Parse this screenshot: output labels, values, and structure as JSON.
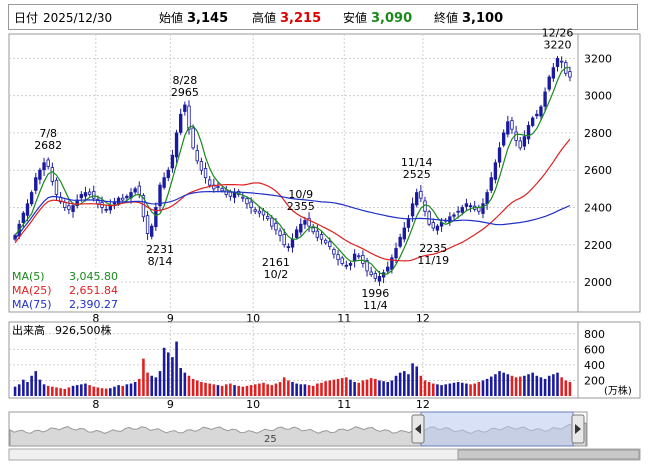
{
  "header": {
    "date_label": "日付",
    "date": "2025/12/30",
    "open_label": "始値",
    "open": "3,145",
    "high_label": "高値",
    "high": "3,215",
    "low_label": "安値",
    "low": "3,090",
    "close_label": "終値",
    "close": "3,100"
  },
  "colors": {
    "up": "#1a1aa0",
    "down": "#ffffff",
    "candle_border": "#1a1aa0",
    "ma5": "#1a8a1a",
    "ma25": "#e02020",
    "ma75": "#2030c8",
    "high_value": "#e00000",
    "low_value": "#1a8a1a",
    "volume_up": "#1a1aa0",
    "volume_down": "#e02020",
    "nav_fill": "#b8c8ee"
  },
  "legend": [
    {
      "label": "MA(5)",
      "value": "3,045.80",
      "color": "#1a8a1a"
    },
    {
      "label": "MA(25)",
      "value": "2,651.84",
      "color": "#e02020"
    },
    {
      "label": "MA(75)",
      "value": "2,390.27",
      "color": "#2030c8"
    }
  ],
  "volume_label": "出来高",
  "volume_value": "926,500株",
  "volume_unit": "(万株)",
  "navigator_label": "25",
  "chart_data": {
    "type": "candlestick",
    "price_ylim": [
      1850,
      3320
    ],
    "price_ticks": [
      2000,
      2200,
      2400,
      2600,
      2800,
      3000,
      3200
    ],
    "volume_ylim": [
      0,
      900
    ],
    "volume_ticks": [
      200,
      400,
      600,
      800
    ],
    "month_labels": [
      {
        "label": "8",
        "month": "2025-08"
      },
      {
        "label": "9",
        "month": "2025-09"
      },
      {
        "label": "10",
        "month": "2025-10"
      },
      {
        "label": "11",
        "month": "2025-11"
      },
      {
        "label": "12",
        "month": "2025-12"
      }
    ],
    "annotations": [
      {
        "date": "7/8",
        "value": "2682",
        "price": 2682,
        "where": "above"
      },
      {
        "date": "8/14",
        "value": "2231",
        "price": 2231,
        "where": "below"
      },
      {
        "date": "8/28",
        "value": "2965",
        "price": 2965,
        "where": "above"
      },
      {
        "date": "10/2",
        "value": "2161",
        "price": 2161,
        "where": "below"
      },
      {
        "date": "10/9",
        "value": "2355",
        "price": 2355,
        "where": "above"
      },
      {
        "date": "11/4",
        "value": "1996",
        "price": 1996,
        "where": "below"
      },
      {
        "date": "11/14",
        "value": "2525",
        "price": 2525,
        "where": "above"
      },
      {
        "date": "11/19",
        "value": "2235",
        "price": 2235,
        "where": "below"
      },
      {
        "date": "12/26",
        "value": "3220",
        "price": 3220,
        "where": "above"
      }
    ],
    "closes": [
      2250,
      2310,
      2370,
      2420,
      2480,
      2560,
      2600,
      2640,
      2620,
      2540,
      2470,
      2430,
      2400,
      2390,
      2410,
      2440,
      2470,
      2480,
      2470,
      2450,
      2420,
      2400,
      2390,
      2410,
      2430,
      2450,
      2440,
      2460,
      2480,
      2500,
      2470,
      2350,
      2260,
      2300,
      2400,
      2520,
      2560,
      2600,
      2680,
      2800,
      2900,
      2950,
      2820,
      2720,
      2650,
      2600,
      2560,
      2520,
      2500,
      2510,
      2490,
      2470,
      2460,
      2480,
      2470,
      2450,
      2420,
      2400,
      2380,
      2370,
      2360,
      2340,
      2300,
      2280,
      2250,
      2200,
      2190,
      2230,
      2280,
      2310,
      2330,
      2300,
      2270,
      2240,
      2230,
      2210,
      2190,
      2150,
      2120,
      2100,
      2090,
      2100,
      2150,
      2140,
      2100,
      2060,
      2040,
      2020,
      2030,
      2050,
      2080,
      2130,
      2180,
      2240,
      2290,
      2340,
      2420,
      2480,
      2450,
      2380,
      2310,
      2290,
      2300,
      2320,
      2330,
      2350,
      2360,
      2380,
      2400,
      2420,
      2410,
      2390,
      2380,
      2420,
      2480,
      2560,
      2640,
      2720,
      2800,
      2860,
      2820,
      2760,
      2720,
      2780,
      2840,
      2880,
      2900,
      2940,
      3020,
      3100,
      3150,
      3200,
      3180,
      3120,
      3100
    ],
    "volumes": [
      120,
      150,
      210,
      180,
      260,
      320,
      210,
      150,
      130,
      120,
      110,
      100,
      90,
      110,
      130,
      140,
      150,
      160,
      140,
      120,
      110,
      100,
      95,
      100,
      120,
      140,
      130,
      150,
      160,
      180,
      220,
      480,
      300,
      260,
      240,
      320,
      620,
      560,
      500,
      700,
      360,
      300,
      260,
      220,
      200,
      180,
      170,
      160,
      150,
      140,
      130,
      150,
      160,
      140,
      130,
      120,
      130,
      140,
      150,
      160,
      170,
      150,
      140,
      160,
      180,
      240,
      200,
      180,
      160,
      150,
      150,
      140,
      130,
      160,
      170,
      190,
      200,
      210,
      220,
      230,
      240,
      210,
      180,
      170,
      200,
      210,
      230,
      220,
      200,
      190,
      180,
      200,
      260,
      300,
      320,
      280,
      420,
      380,
      260,
      200,
      180,
      160,
      150,
      140,
      150,
      160,
      170,
      180,
      170,
      160,
      150,
      160,
      180,
      200,
      220,
      250,
      280,
      320,
      300,
      280,
      260,
      240,
      250,
      260,
      280,
      300,
      260,
      240,
      220,
      260,
      280,
      300,
      240,
      200,
      180
    ],
    "ma5_last": 3045.8,
    "ma25_last": 2651.84,
    "ma75_last": 2390.27,
    "ohlc_last": {
      "open": 3145,
      "high": 3215,
      "low": 3090,
      "close": 3100,
      "volume": 926500
    }
  }
}
